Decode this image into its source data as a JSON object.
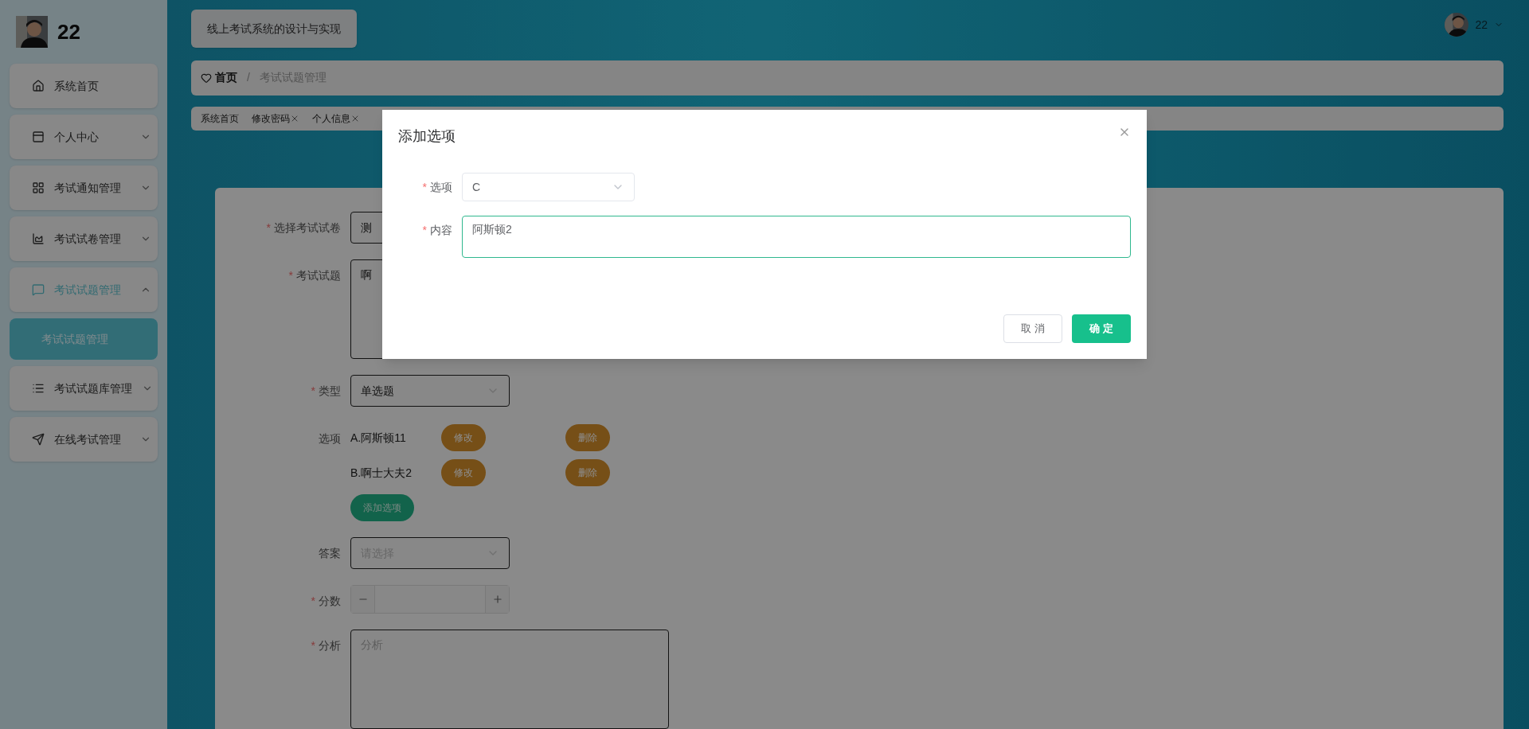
{
  "sidebar": {
    "user": "22",
    "items": [
      {
        "label": "系统首页",
        "kind": "link",
        "selected": false
      },
      {
        "label": "个人中心",
        "kind": "menu",
        "expanded": false,
        "selected": false
      },
      {
        "label": "考试通知管理",
        "kind": "menu",
        "expanded": false,
        "selected": false
      },
      {
        "label": "考试试卷管理",
        "kind": "menu",
        "expanded": false,
        "selected": false
      },
      {
        "label": "考试试题管理",
        "kind": "menu",
        "expanded": true,
        "selected": true,
        "children": [
          {
            "label": "考试试题管理",
            "selected": true
          }
        ]
      },
      {
        "label": "考试试题库管理",
        "kind": "menu",
        "expanded": false,
        "selected": false
      },
      {
        "label": "在线考试管理",
        "kind": "menu",
        "expanded": false,
        "selected": false
      }
    ]
  },
  "header": {
    "title": "线上考试系统的设计与实现",
    "user": "22"
  },
  "breadcrumb": {
    "separator": "/",
    "items": [
      "首页",
      "考试试题管理"
    ]
  },
  "tags": [
    {
      "label": "系统首页",
      "closable": false
    },
    {
      "label": "修改密码",
      "closable": true
    },
    {
      "label": "个人信息",
      "closable": true
    }
  ],
  "form": {
    "fields": [
      {
        "kind": "select",
        "label": "选择考试试卷",
        "mark": "*",
        "value": "测"
      },
      {
        "kind": "textarea",
        "label": "考试试题",
        "mark": "*",
        "value": "啊"
      },
      {
        "kind": "select",
        "label": "类型",
        "mark": "*",
        "value": "单选题"
      },
      {
        "kind": "options",
        "label": "选项",
        "options": [
          {
            "text": "A.阿斯顿11",
            "edit": "修改",
            "delete": "删除"
          },
          {
            "text": "B.啊士大夫2",
            "edit": "修改",
            "delete": "删除"
          }
        ],
        "add": "添加选项"
      },
      {
        "kind": "select",
        "label": "答案",
        "placeholder": "请选择"
      },
      {
        "kind": "number",
        "label": "分数",
        "mark": "*"
      },
      {
        "kind": "textarea",
        "label": "分析",
        "mark": "*",
        "placeholder": "分析"
      }
    ]
  },
  "dialog": {
    "title": "添加选项",
    "fields": [
      {
        "kind": "select",
        "label": "选项",
        "mark": "*",
        "value": "C"
      },
      {
        "kind": "textarea",
        "label": "内容",
        "mark": "*",
        "value": "阿斯顿2",
        "focused": true
      }
    ],
    "buttons": [
      {
        "label": "取 消",
        "kind": "default"
      },
      {
        "label": "确 定",
        "kind": "primary"
      }
    ]
  }
}
